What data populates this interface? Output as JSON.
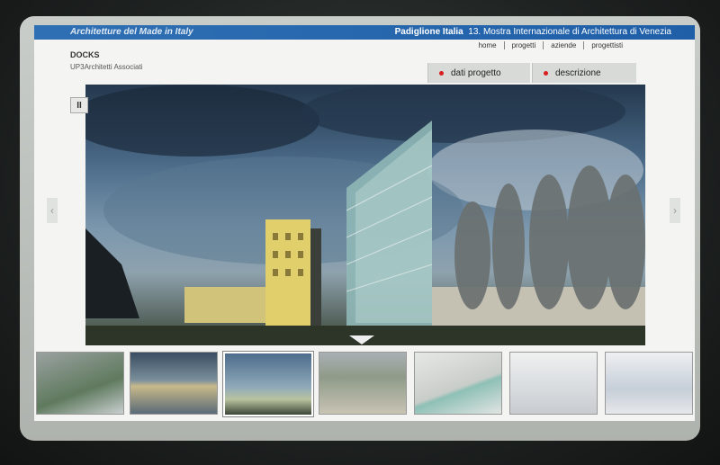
{
  "header": {
    "brand": "Architetture del Made in Italy",
    "event_bold": "Padiglione Italia",
    "event_rest": "13. Mostra Internazionale di Architettura di Venezia"
  },
  "nav": [
    {
      "label": "home"
    },
    {
      "label": "progetti"
    },
    {
      "label": "aziende"
    },
    {
      "label": "progettisti"
    }
  ],
  "project": {
    "title": "DOCKS",
    "architect": "UP3Architetti Associati"
  },
  "tabs": [
    {
      "label": "dati progetto"
    },
    {
      "label": "descrizione"
    }
  ],
  "controls": {
    "pause_label": "II",
    "prev_label": "‹",
    "next_label": "›"
  },
  "thumbnails_count": 7,
  "colors": {
    "header_bar": "#1f5fa8",
    "tab_dot": "#d81e1e",
    "tab_bg": "#d8dad8"
  }
}
